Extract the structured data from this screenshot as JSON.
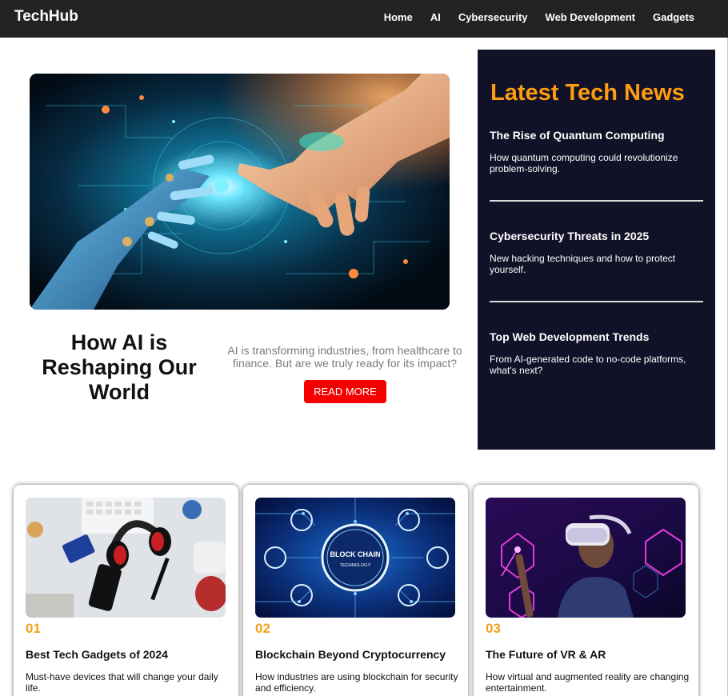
{
  "nav": {
    "brand": "TechHub",
    "links": [
      "Home",
      "AI",
      "Cybersecurity",
      "Web Development",
      "Gadgets"
    ]
  },
  "hero": {
    "title": "How AI is Reshaping Our World",
    "description": "AI is transforming industries, from healthcare to finance. But are we truly ready for its impact?",
    "button_label": "READ MORE"
  },
  "sidebar": {
    "title": "Latest Tech News",
    "items": [
      {
        "title": "The Rise of Quantum Computing",
        "description": "How quantum computing could revolutionize problem-solving."
      },
      {
        "title": "Cybersecurity Threats in 2025",
        "description": "New hacking techniques and how to protect yourself."
      },
      {
        "title": "Top Web Development Trends",
        "description": "From AI-generated code to no-code platforms, what's next?"
      }
    ]
  },
  "cards": [
    {
      "number": "01",
      "title": "Best Tech Gadgets of 2024",
      "description": "Must-have devices that will change your daily life.",
      "image": "gadgets-flatlay-image"
    },
    {
      "number": "02",
      "title": "Blockchain Beyond Cryptocurrency",
      "description": "How industries are using blockchain for security and efficiency.",
      "image": "blockchain-circuit-image",
      "image_text": [
        "BLOCK CHAIN",
        "TECHNOLOGY"
      ]
    },
    {
      "number": "03",
      "title": "The Future of VR & AR",
      "description": "How virtual and augmented reality are changing entertainment.",
      "image": "vr-headset-person-image"
    }
  ],
  "colors": {
    "navbar": "#232323",
    "sidebar_bg": "#111128",
    "sidebar_title": "#ff9d10",
    "accent_button": "#f40000",
    "card_number": "#f1a21e",
    "hero_desc": "#7b7b7b"
  }
}
